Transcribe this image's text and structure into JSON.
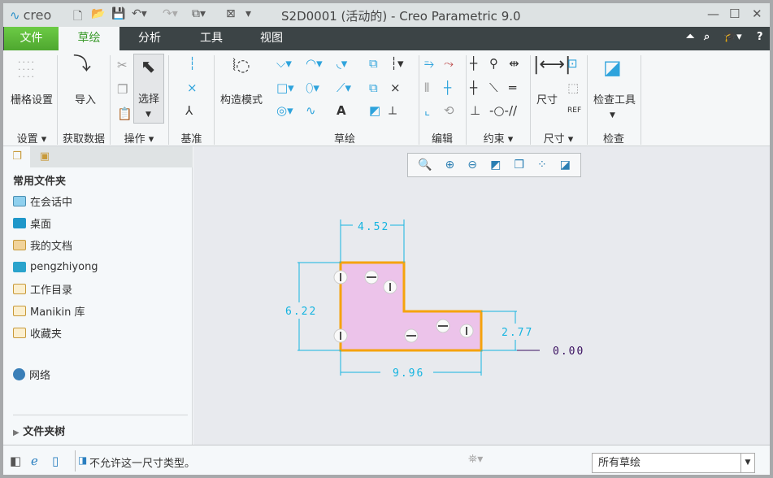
{
  "app": {
    "logo": "creo",
    "title": "S2D0001 (活动的) - Creo Parametric 9.0"
  },
  "tabs": [
    "文件",
    "草绘",
    "分析",
    "工具",
    "视图"
  ],
  "ribbon": {
    "grid_settings": "栅格设置",
    "import": "导入",
    "select": "选择",
    "construction_mode": "构造模式",
    "dimension": "尺寸",
    "inspect_tools": "检查工具",
    "groups": {
      "settings": "设置",
      "get_data": "获取数据",
      "operations": "操作",
      "datum": "基准",
      "sketch": "草绘",
      "edit": "编辑",
      "constrain": "约束",
      "dimension": "尺寸",
      "inspect": "检查"
    }
  },
  "left_panel": {
    "heading": "常用文件夹",
    "items": [
      "在会话中",
      "桌面",
      "我的文档",
      "pengzhiyong",
      "工作目录",
      "Manikin 库",
      "收藏夹"
    ],
    "network": "网络",
    "folder_tree": "文件夹树"
  },
  "sketch": {
    "dims": {
      "top": "4.52",
      "left": "6.22",
      "right": "2.77",
      "bottom": "9.96",
      "baseline": "0.00"
    },
    "fill": "#ecc3ea",
    "outline": "#f5a30e",
    "dim_color": "#15b4e0"
  },
  "status": {
    "message": "不允许这一尺寸类型。",
    "filter": "所有草绘"
  }
}
